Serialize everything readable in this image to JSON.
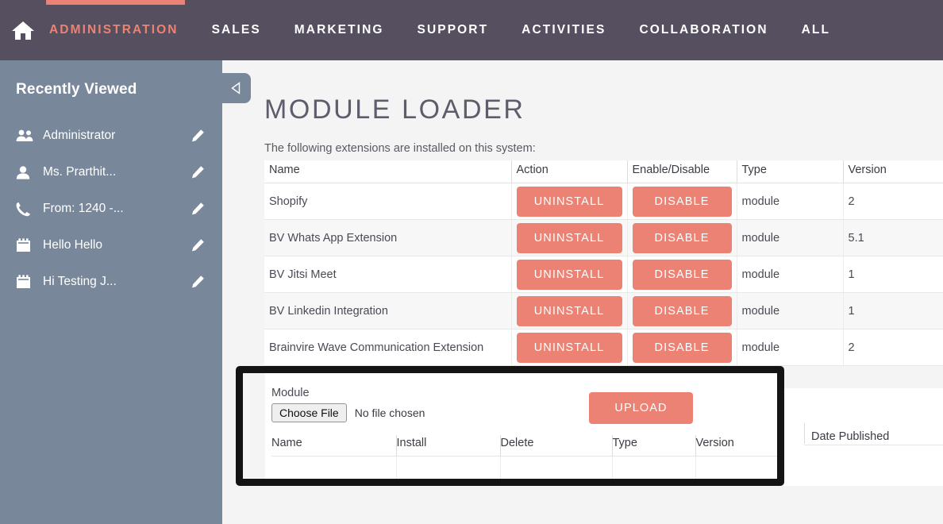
{
  "topnav": {
    "home_icon": "home-icon",
    "accent_color": "#ec8273",
    "background_color": "#564f60",
    "items": [
      {
        "label": "ADMINISTRATION",
        "active": true
      },
      {
        "label": "SALES",
        "active": false
      },
      {
        "label": "MARKETING",
        "active": false
      },
      {
        "label": "SUPPORT",
        "active": false
      },
      {
        "label": "ACTIVITIES",
        "active": false
      },
      {
        "label": "COLLABORATION",
        "active": false
      },
      {
        "label": "ALL",
        "active": false
      }
    ]
  },
  "sidebar": {
    "title": "Recently Viewed",
    "background_color": "#78879a",
    "collapse_icon": "chevron-left-icon",
    "items": [
      {
        "label": "Administrator",
        "icon": "users-icon",
        "edit_icon": "pencil-icon"
      },
      {
        "label": "Ms. Prarthit...",
        "icon": "user-icon",
        "edit_icon": "pencil-icon"
      },
      {
        "label": "From: 1240 -...",
        "icon": "phone-icon",
        "edit_icon": "pencil-icon"
      },
      {
        "label": "Hello Hello",
        "icon": "calendar-icon",
        "edit_icon": "pencil-icon"
      },
      {
        "label": "Hi Testing J...",
        "icon": "calendar-icon",
        "edit_icon": "pencil-icon"
      }
    ]
  },
  "main": {
    "page_title": "MODULE LOADER",
    "subtitle": "The following extensions are installed on this system:",
    "extensions_table": {
      "headers": [
        "Name",
        "Action",
        "Enable/Disable",
        "Type",
        "Version"
      ],
      "rows": [
        {
          "name": "Shopify",
          "action": "UNINSTALL",
          "enable_disable": "DISABLE",
          "type": "module",
          "version": "2"
        },
        {
          "name": "BV Whats App Extension",
          "action": "UNINSTALL",
          "enable_disable": "DISABLE",
          "type": "module",
          "version": "5.1"
        },
        {
          "name": "BV Jitsi Meet",
          "action": "UNINSTALL",
          "enable_disable": "DISABLE",
          "type": "module",
          "version": "1"
        },
        {
          "name": "BV Linkedin Integration",
          "action": "UNINSTALL",
          "enable_disable": "DISABLE",
          "type": "module",
          "version": "1"
        },
        {
          "name": "Brainvire Wave Communication Extension",
          "action": "UNINSTALL",
          "enable_disable": "DISABLE",
          "type": "module",
          "version": "2"
        }
      ]
    },
    "progress_bar": {
      "color": "#96dbc2"
    },
    "button_color": "#ec8273"
  },
  "upload_panel": {
    "module_label": "Module",
    "choose_file_label": "Choose File",
    "no_file_text": "No file chosen",
    "upload_label": "UPLOAD",
    "highlight_color": "#141414",
    "table": {
      "headers": [
        "Name",
        "Install",
        "Delete",
        "Type",
        "Version",
        "Date Published"
      ],
      "rows": []
    }
  }
}
